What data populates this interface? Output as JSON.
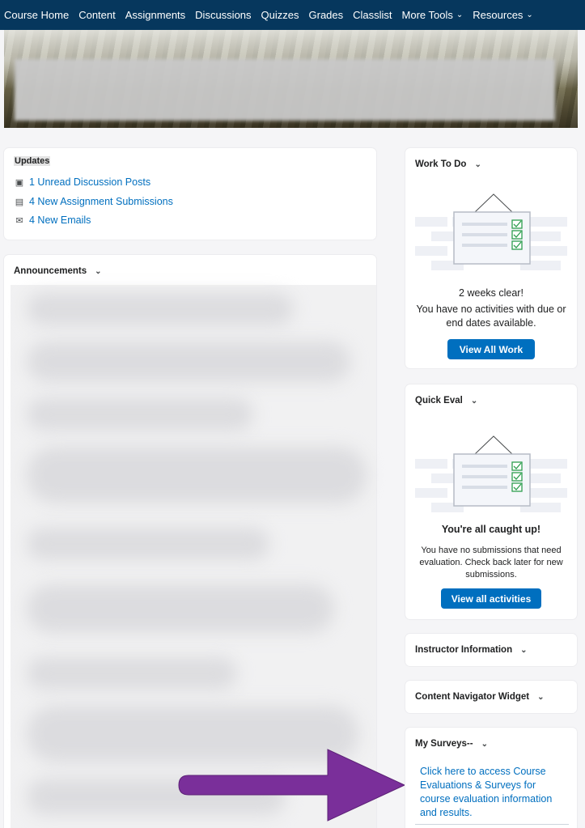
{
  "nav": {
    "items": [
      "Course Home",
      "Content",
      "Assignments",
      "Discussions",
      "Quizzes",
      "Grades",
      "Classlist"
    ],
    "more_tools": "More Tools",
    "resources": "Resources"
  },
  "updates": {
    "title": "Updates",
    "items": [
      {
        "icon": "discussion-icon",
        "text": "1 Unread Discussion Posts"
      },
      {
        "icon": "assignment-icon",
        "text": "4 New Assignment Submissions"
      },
      {
        "icon": "email-icon",
        "text": "4 New Emails"
      }
    ]
  },
  "announcements": {
    "title": "Announcements"
  },
  "work_to_do": {
    "title": "Work To Do",
    "headline": "2 weeks clear!",
    "message": "You have no activities with due or end dates available.",
    "button": "View All Work"
  },
  "quick_eval": {
    "title": "Quick Eval",
    "headline": "You're all caught up!",
    "message": "You have no submissions that need evaluation. Check back later for new submissions.",
    "button": "View all activities"
  },
  "instructor_info": {
    "title": "Instructor Information"
  },
  "content_navigator": {
    "title": "Content Navigator Widget"
  },
  "my_surveys": {
    "title": "My Surveys--",
    "link": "Click here to access Course Evaluations & Surveys for course evaluation information and results."
  },
  "colors": {
    "nav_bg": "#06375d",
    "link": "#006fbf",
    "button": "#006fbf",
    "arrow": "#7a2f9a"
  }
}
